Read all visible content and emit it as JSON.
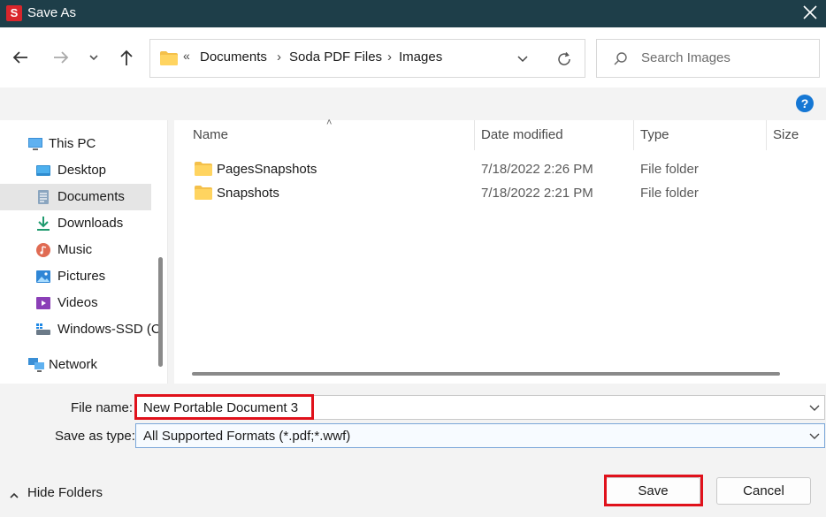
{
  "window": {
    "title": "Save As",
    "app_icon_letter": "S",
    "title_bg_color": "#1e3e49",
    "app_icon_color": "#d9262c"
  },
  "nav": {
    "back_icon": "arrow-left-icon",
    "forward_icon": "arrow-right-icon",
    "recent_icon": "chevron-down-icon",
    "up_icon": "arrow-up-icon"
  },
  "address_bar": {
    "overflow_glyph": "«",
    "breadcrumbs": [
      "Documents",
      "Soda PDF Files",
      "Images"
    ],
    "separator": "›"
  },
  "search": {
    "placeholder": "Search Images"
  },
  "help": {
    "label": "?",
    "color": "#1577d4"
  },
  "sidebar": {
    "items": [
      {
        "label": "This PC",
        "icon": "monitor-icon"
      },
      {
        "label": "Desktop",
        "icon": "desktop-icon"
      },
      {
        "label": "Documents",
        "icon": "documents-icon",
        "selected": true
      },
      {
        "label": "Downloads",
        "icon": "download-icon"
      },
      {
        "label": "Music",
        "icon": "music-icon"
      },
      {
        "label": "Pictures",
        "icon": "pictures-icon"
      },
      {
        "label": "Videos",
        "icon": "videos-icon"
      },
      {
        "label": "Windows-SSD (C",
        "icon": "drive-icon"
      },
      {
        "label": "Network",
        "icon": "network-icon"
      }
    ]
  },
  "file_list": {
    "columns": [
      "Name",
      "Date modified",
      "Type",
      "Size"
    ],
    "rows": [
      {
        "name": "PagesSnapshots",
        "date": "7/18/2022 2:26 PM",
        "type": "File folder",
        "size": ""
      },
      {
        "name": "Snapshots",
        "date": "7/18/2022 2:21 PM",
        "type": "File folder",
        "size": ""
      }
    ]
  },
  "form": {
    "file_name_label": "File name:",
    "file_name_value": "New Portable Document 3",
    "save_type_label": "Save as type:",
    "save_type_value": "All Supported Formats (*.pdf;*.wwf)",
    "highlight_color": "#e0111b"
  },
  "footer": {
    "hide_folders_label": "Hide Folders",
    "save_label": "Save",
    "cancel_label": "Cancel"
  }
}
